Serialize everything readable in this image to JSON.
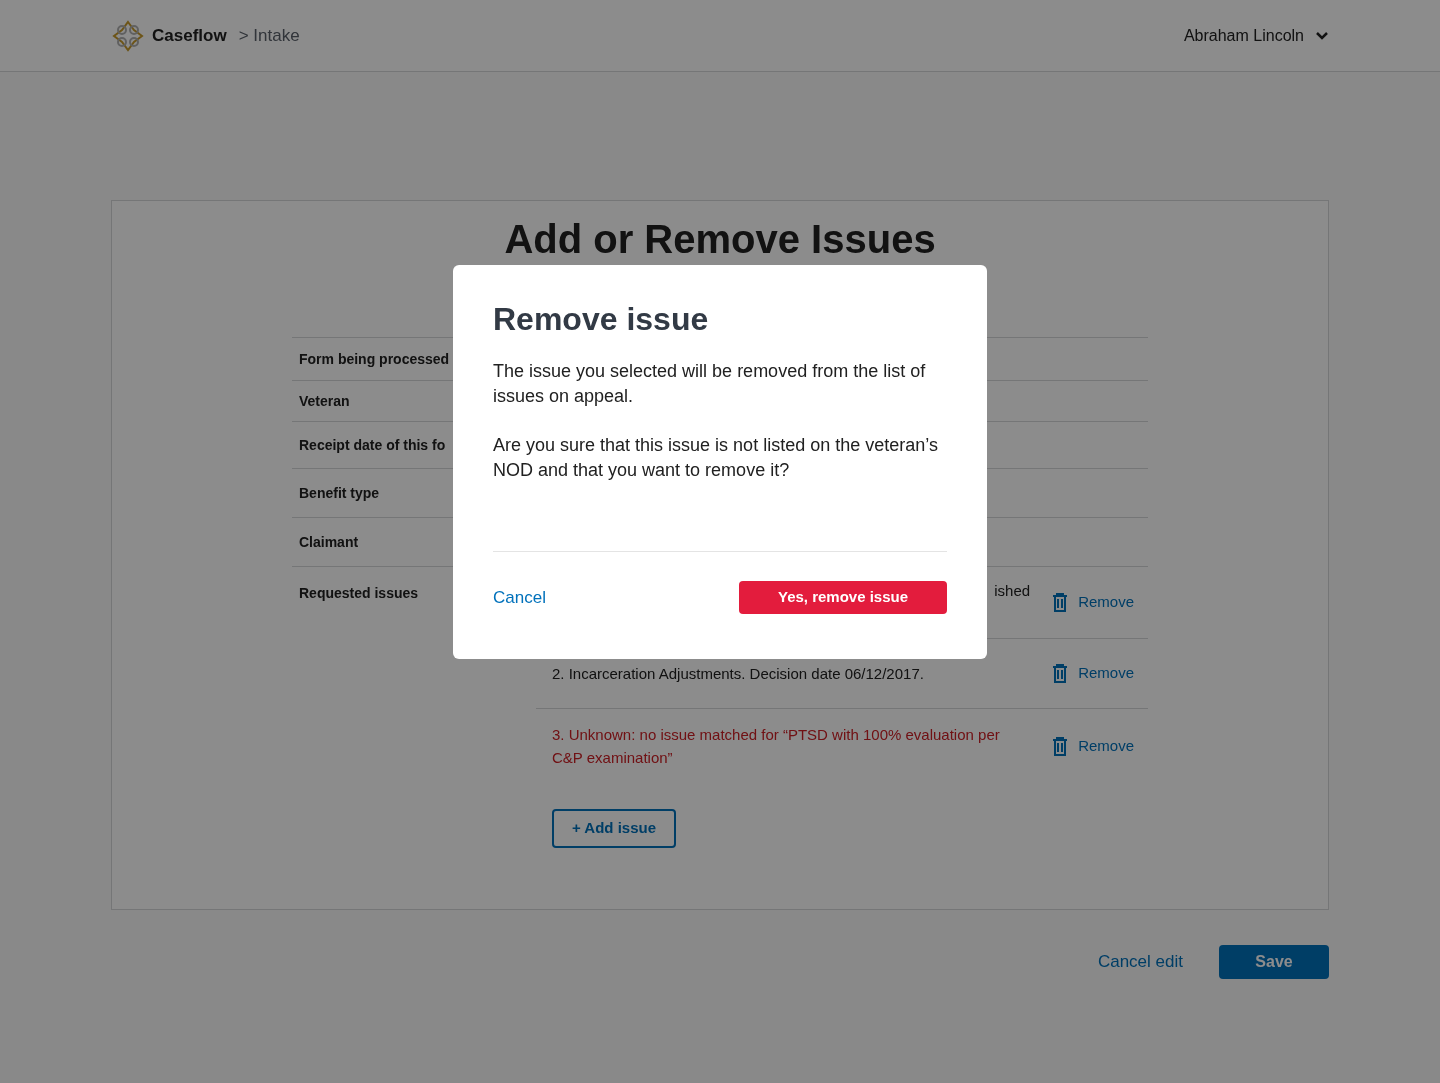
{
  "header": {
    "app": "Caseflow",
    "breadcrumb": "> Intake",
    "user": "Abraham Lincoln"
  },
  "page": {
    "title": "Add or Remove Issues",
    "fields": [
      {
        "label": "Form being processed"
      },
      {
        "label": "Veteran"
      },
      {
        "label": "Receipt date of this fo"
      },
      {
        "label": "Benefit type"
      },
      {
        "label": "Claimant"
      }
    ],
    "requested_label": "Requested issues",
    "issues": [
      {
        "text": "ished",
        "kind": "matched",
        "action": "Remove"
      },
      {
        "text": "2. Incarceration Adjustments. Decision date 06/12/2017.",
        "kind": "matched",
        "action": "Remove"
      },
      {
        "text": "3. Unknown: no issue matched for “PTSD with 100% evaluation per C&P examination”",
        "kind": "unmatched",
        "action": "Remove"
      }
    ],
    "add_button": "+ Add issue"
  },
  "footer": {
    "cancel": "Cancel edit",
    "save": "Save"
  },
  "modal": {
    "title": "Remove issue",
    "paragraphs": [
      "The issue you selected will be removed from the list of issues on appeal.",
      "Are you sure that this issue is not listed on the veteran’s NOD and that you want to remove it?"
    ],
    "cancel": "Cancel",
    "confirm": "Yes, remove issue"
  }
}
